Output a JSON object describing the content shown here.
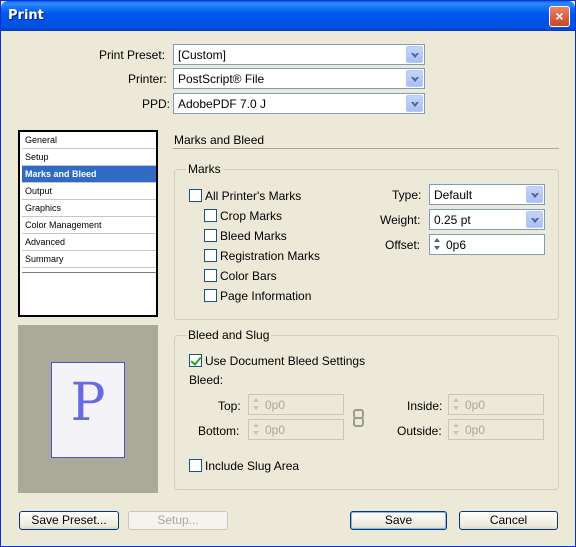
{
  "window": {
    "title": "Print",
    "close_label": "×"
  },
  "header": {
    "preset_label": "Print Preset:",
    "preset_value": "[Custom]",
    "printer_label": "Printer:",
    "printer_value": "PostScript® File",
    "ppd_label": "PPD:",
    "ppd_value": "AdobePDF 7.0 J"
  },
  "sidebar": {
    "items": [
      {
        "label": "General"
      },
      {
        "label": "Setup"
      },
      {
        "label": "Marks and Bleed",
        "selected": true
      },
      {
        "label": "Output"
      },
      {
        "label": "Graphics"
      },
      {
        "label": "Color Management"
      },
      {
        "label": "Advanced"
      },
      {
        "label": "Summary"
      }
    ]
  },
  "preview": {
    "glyph": "P"
  },
  "section_title": "Marks and Bleed",
  "marks": {
    "group_title": "Marks",
    "all_printers_marks": {
      "label": "All Printer's Marks",
      "checked": false
    },
    "crop_marks": {
      "label": "Crop Marks",
      "checked": false
    },
    "bleed_marks": {
      "label": "Bleed Marks",
      "checked": false
    },
    "registration_marks": {
      "label": "Registration Marks",
      "checked": false
    },
    "color_bars": {
      "label": "Color Bars",
      "checked": false
    },
    "page_information": {
      "label": "Page Information",
      "checked": false
    },
    "type_label": "Type:",
    "type_value": "Default",
    "weight_label": "Weight:",
    "weight_value": "0.25 pt",
    "offset_label": "Offset:",
    "offset_value": "0p6"
  },
  "bleed": {
    "group_title": "Bleed and Slug",
    "use_document": {
      "label": "Use Document Bleed Settings",
      "checked": true
    },
    "bleed_label": "Bleed:",
    "top_label": "Top:",
    "top_value": "0p0",
    "bottom_label": "Bottom:",
    "bottom_value": "0p0",
    "inside_label": "Inside:",
    "inside_value": "0p0",
    "outside_label": "Outside:",
    "outside_value": "0p0",
    "include_slug": {
      "label": "Include Slug Area",
      "checked": false
    }
  },
  "footer": {
    "save_preset_label": "Save Preset...",
    "setup_label": "Setup...",
    "save_label": "Save",
    "cancel_label": "Cancel"
  }
}
